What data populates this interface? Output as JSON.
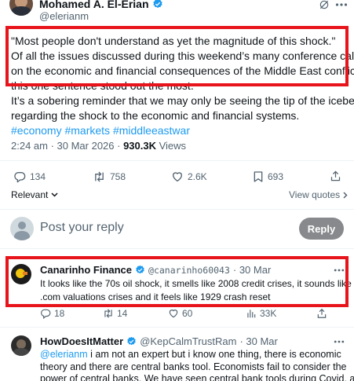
{
  "main_tweet": {
    "author_name": "Mohamed A. El-Erian",
    "author_handle": "@elerianm",
    "quote_line": "\"Most people don't understand as yet the magnitude of this shock.\"",
    "body_line1": "Of all the issues discussed during this weekend’s many conference calls",
    "body_line2": "on the economic and financial consequences of the Middle East conflict,",
    "body_line3": "this one sentence stood out the most.",
    "body_line4": "It’s a sobering reminder that we may only be seeing the tip of the iceberg",
    "body_line5": "regarding the shock to the economic and financial systems.",
    "hashtags": "#economy #markets #middleeastwar",
    "time": "2:24 am · 30 Mar 2026 · ",
    "views_count": "930.3K",
    "views_label": " Views",
    "stats": {
      "replies": "134",
      "reposts": "758",
      "likes": "2.6K",
      "views": "693"
    }
  },
  "sort": {
    "relevant_label": "Relevant",
    "view_quotes_label": "View quotes"
  },
  "composer": {
    "placeholder": "Post your reply",
    "reply_button": "Reply"
  },
  "replies": [
    {
      "author_name": "Canarinho Finance",
      "author_handle": "@canarinho60043",
      "date": "· 30 Mar",
      "line1": "It looks like the 70s oil shock, it smells like 2008 credit crises, it sounds like",
      "line2": ".com valuations crises and it feels like 1929 crash reset",
      "stats": {
        "replies": "18",
        "reposts": "14",
        "likes": "60",
        "views": "33K"
      }
    },
    {
      "author_name": "HowDoesItMatter",
      "author_handle": "@KepCalmTrustRam",
      "date": "· 30 Mar",
      "mention": "@elerianm",
      "line1_rest": " i am not an expert but i know one thing, there is economic",
      "line2": "theory and there are central banks tool. Economists fail to consider the",
      "line3": "power of central banks. We have seen central bank tools during Covid, and I"
    }
  ],
  "colors": {
    "accent": "#1d9bf0",
    "verified": "#1d9bf0",
    "highlight_box": "#e8141c",
    "reply_button_bg": "#87898c"
  }
}
